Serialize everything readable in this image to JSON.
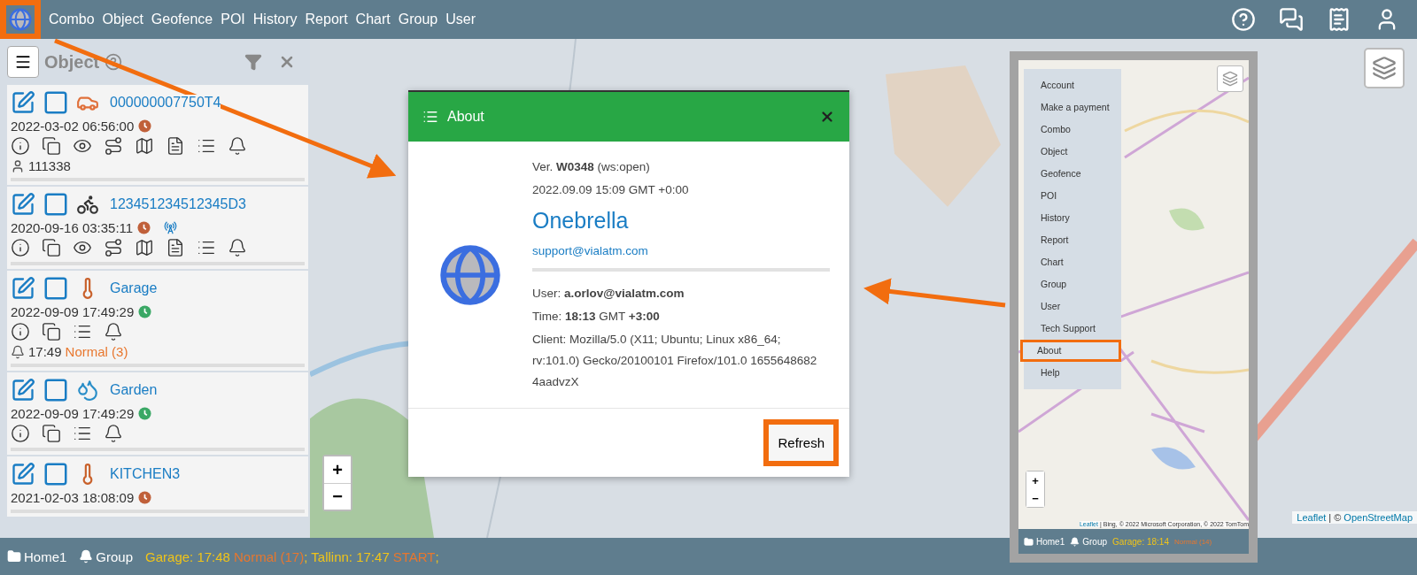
{
  "nav": {
    "logo_highlighted": true,
    "items": [
      "Combo",
      "Object",
      "Geofence",
      "POI",
      "History",
      "Report",
      "Chart",
      "Group",
      "User"
    ]
  },
  "panel": {
    "title": "Object",
    "objects": [
      {
        "name": "000000007750T4",
        "kind": "car",
        "checked": false,
        "time": "2022-03-02 06:56:00",
        "color": "#c0603a",
        "signal": false,
        "actions": [
          {
            "kind": "info"
          },
          {
            "kind": "windows"
          },
          {
            "kind": "eye"
          },
          {
            "kind": "route"
          },
          {
            "kind": "map"
          },
          {
            "kind": "document"
          },
          {
            "kind": "list"
          },
          {
            "kind": "bell"
          }
        ],
        "extra": {
          "kind": "user",
          "text": "111338"
        }
      },
      {
        "name": "123451234512345D3",
        "kind": "motorcycle",
        "checked": false,
        "time": "2020-09-16 03:35:11",
        "color": "#c0603a",
        "signal": true,
        "actions": [
          {
            "kind": "info"
          },
          {
            "kind": "windows"
          },
          {
            "kind": "eye"
          },
          {
            "kind": "route"
          },
          {
            "kind": "map"
          },
          {
            "kind": "document"
          },
          {
            "kind": "list"
          },
          {
            "kind": "bell"
          }
        ]
      },
      {
        "name": "Garage",
        "kind": "thermometer",
        "checked": false,
        "time": "2022-09-09 17:49:29",
        "color": "#3aa865",
        "signal": false,
        "actions": [
          {
            "kind": "info"
          },
          {
            "kind": "windows"
          },
          {
            "kind": "list"
          },
          {
            "kind": "bell"
          }
        ],
        "extra": {
          "kind": "alert",
          "text": "17:49",
          "status": "Normal (3)"
        }
      },
      {
        "name": "Garden",
        "kind": "tap",
        "checked": false,
        "time": "2022-09-09 17:49:29",
        "color": "#3aa865",
        "signal": false,
        "actions": [
          {
            "kind": "info"
          },
          {
            "kind": "windows"
          },
          {
            "kind": "list"
          },
          {
            "kind": "bell"
          }
        ]
      },
      {
        "name": "KITCHEN3",
        "kind": "thermometer",
        "checked": false,
        "time": "2021-02-03 18:08:09",
        "color": "#c0603a",
        "signal": false
      }
    ]
  },
  "map": {
    "zoom_in": "+",
    "zoom_out": "−",
    "attribution": {
      "link": "Leaflet",
      "middle": "| ©",
      "source": "OpenStreetMap"
    }
  },
  "dialog": {
    "title": "About",
    "version": "Ver. **W0348** (ws:open)",
    "build_date": "2022.09.09 15:09 GMT +0:00",
    "product": "Onebrella",
    "email": "support@vialatm.com",
    "user": "User: **a.orlov@vialatm.com**",
    "time": "Time: **18:13** GMT **+3:00**",
    "client": "Client: Mozilla/5.0 (X11; Ubuntu; Linux x86_64; rv:101.0) Gecko/20100101 Firefox/101.0 1655648682 4aadvzX",
    "refresh": {
      "label": "Refresh",
      "highlighted": true
    }
  },
  "inset": {
    "menu": [
      {
        "label": "Account",
        "selected": false
      },
      {
        "label": "Make a payment",
        "selected": false
      },
      {
        "label": "Combo",
        "selected": false
      },
      {
        "label": "Object",
        "selected": false
      },
      {
        "label": "Geofence",
        "selected": false
      },
      {
        "label": "POI",
        "selected": false
      },
      {
        "label": "History",
        "selected": false
      },
      {
        "label": "Report",
        "selected": false
      },
      {
        "label": "Chart",
        "selected": false
      },
      {
        "label": "Group",
        "selected": false
      },
      {
        "label": "User",
        "selected": false
      },
      {
        "label": "Tech Support",
        "selected": false
      },
      {
        "label": "About",
        "selected": true
      },
      {
        "label": "Help",
        "selected": false
      }
    ],
    "zoom_in": "+",
    "zoom_out": "−",
    "attribution_link": "Leaflet",
    "attribution": "| Bing, © 2022 Microsoft Corporation, © 2022 TomTom",
    "status_bar": {
      "folder": "Home1",
      "group": "Group",
      "alerts": [
        {
          "label": "Garage: 18:14",
          "status": "Normal (14)"
        }
      ]
    }
  },
  "status_bar": {
    "folder": "Home1",
    "group": "Group",
    "alerts": [
      {
        "label": "Garage: 17:48",
        "status": "Normal (17)",
        "end": ";"
      },
      {
        "label": "Tallinn: 17:47",
        "status": "START",
        "end": ";"
      }
    ]
  }
}
